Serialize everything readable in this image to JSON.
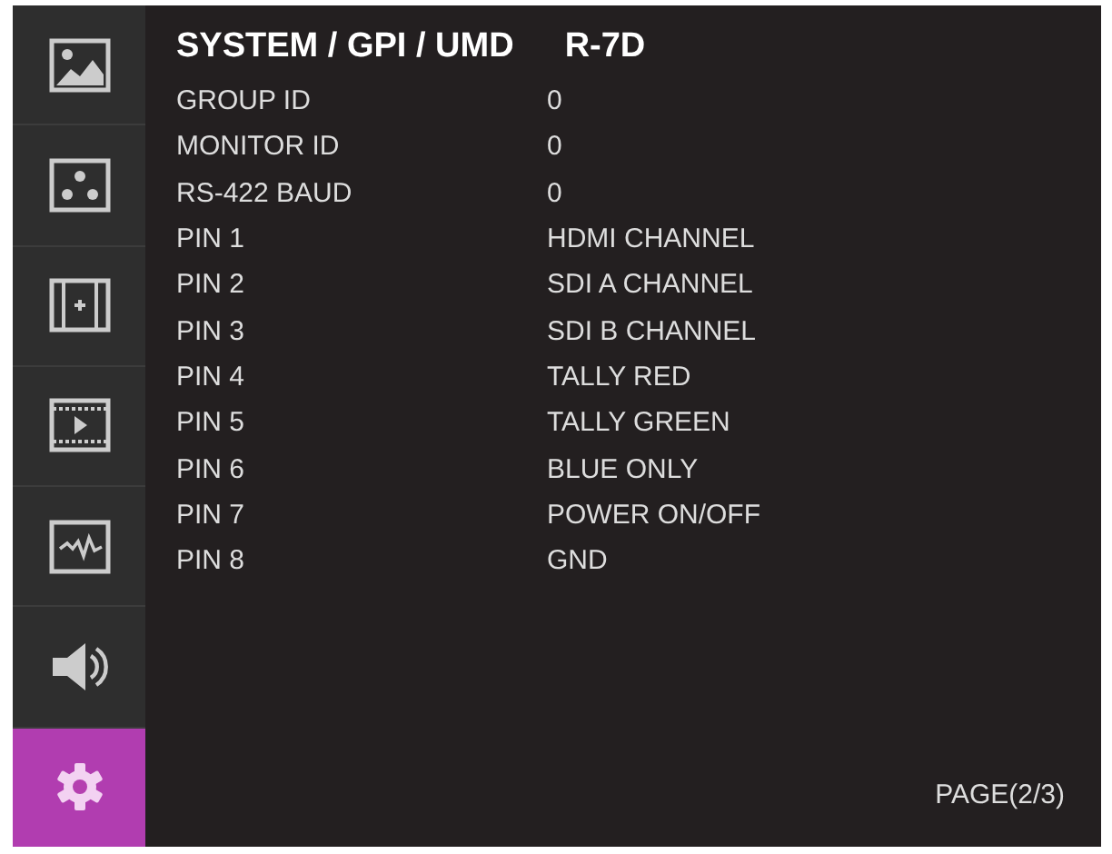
{
  "sidebar": {
    "tabs": [
      {
        "selected": false
      },
      {
        "selected": false
      },
      {
        "selected": false
      },
      {
        "selected": false
      },
      {
        "selected": false
      },
      {
        "selected": false
      },
      {
        "selected": true
      }
    ]
  },
  "menu": {
    "title": "SYSTEM / GPI / UMD",
    "model": "R-7D",
    "rows": [
      {
        "label": "GROUP ID",
        "value": "0"
      },
      {
        "label": "MONITOR ID",
        "value": "0"
      },
      {
        "label": "RS-422 BAUD",
        "value": "0"
      },
      {
        "label": "PIN 1",
        "value": "HDMI CHANNEL"
      },
      {
        "label": "PIN 2",
        "value": "SDI A CHANNEL"
      },
      {
        "label": "PIN 3",
        "value": "SDI B CHANNEL"
      },
      {
        "label": "PIN 4",
        "value": "TALLY RED"
      },
      {
        "label": "PIN 5",
        "value": "TALLY GREEN"
      },
      {
        "label": "PIN 6",
        "value": "BLUE ONLY"
      },
      {
        "label": "PIN 7",
        "value": "POWER ON/OFF"
      },
      {
        "label": "PIN 8",
        "value": "GND"
      }
    ],
    "page": "PAGE(2/3)"
  }
}
